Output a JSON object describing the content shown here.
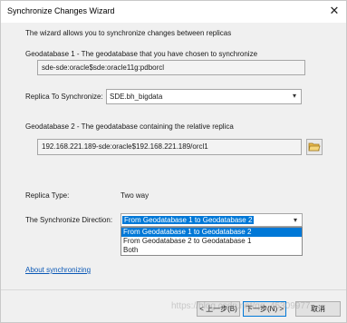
{
  "window": {
    "title": "Synchronize Changes Wizard",
    "close_glyph": "✕"
  },
  "intro": "The wizard allows you to synchronize changes between replicas",
  "gdb1": {
    "label": "Geodatabase 1 - The geodatabase that you have chosen to synchronize",
    "value": "sde-sde:oracle$sde:oracle11g:pdborcl"
  },
  "replica": {
    "label": "Replica To Synchronize:",
    "value": "SDE.bh_bigdata"
  },
  "gdb2": {
    "label": "Geodatabase 2 - The geodatabase containing the relative replica",
    "value": "192.168.221.189-sde:oracle$192.168.221.189/orcl1"
  },
  "replica_type": {
    "label": "Replica Type:",
    "value": "Two way"
  },
  "direction": {
    "label": "The Synchronize Direction:",
    "value": "From Geodatabase 1 to Geodatabase 2",
    "options": [
      "From Geodatabase 1 to Geodatabase 2",
      "From Geodatabase 2 to Geodatabase 1",
      "Both"
    ]
  },
  "about_link": "About synchronizing",
  "buttons": {
    "back": "< 上一步(B)",
    "next": "下一步(N) >",
    "cancel": "取消"
  },
  "watermark": "https://blog.csdn.net/qq_45309977",
  "colors": {
    "selection": "#0078d7",
    "link": "#0a58b6"
  }
}
